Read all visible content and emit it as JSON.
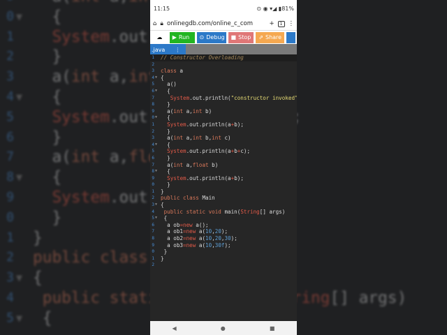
{
  "status": {
    "time": "11:15",
    "battery": "81%"
  },
  "browser": {
    "url": "onlinegdb.com/online_c_com",
    "tabs_count": "1"
  },
  "toolbar": {
    "run": "Run",
    "debug": "Debug",
    "stop": "Stop",
    "share": "Share"
  },
  "file_tab": {
    "name": ".java"
  },
  "colors": {
    "run": "#22b522",
    "debug": "#2c79c8",
    "stop": "#e07777",
    "share": "#f5a850",
    "gutter": "#4a8fd8"
  },
  "code_lines": [
    [
      [
        "c",
        "// Constructor Overloading"
      ]
    ],
    [],
    [
      [
        "k",
        "class"
      ],
      [
        "t",
        " a"
      ]
    ],
    [
      [
        "t",
        "{"
      ]
    ],
    [
      [
        "t",
        "  a()"
      ]
    ],
    [
      [
        "t",
        "  {"
      ]
    ],
    [
      [
        "t",
        "   "
      ],
      [
        "s",
        "System"
      ],
      [
        "t",
        ".out.println("
      ],
      [
        "str",
        "\"constructor invoked\""
      ],
      [
        "t",
        ");"
      ]
    ],
    [
      [
        "t",
        "  }"
      ]
    ],
    [
      [
        "t",
        "  a("
      ],
      [
        "k",
        "int"
      ],
      [
        "t",
        " a,"
      ],
      [
        "k",
        "int"
      ],
      [
        "t",
        " b)"
      ]
    ],
    [
      [
        "t",
        "  {"
      ]
    ],
    [
      [
        "t",
        "  "
      ],
      [
        "s",
        "System"
      ],
      [
        "t",
        ".out.println(a"
      ],
      [
        "s",
        "+"
      ],
      [
        "t",
        "b);"
      ]
    ],
    [
      [
        "t",
        "  }"
      ]
    ],
    [
      [
        "t",
        "  a("
      ],
      [
        "k",
        "int"
      ],
      [
        "t",
        " a,"
      ],
      [
        "k",
        "int"
      ],
      [
        "t",
        " b,"
      ],
      [
        "k",
        "int"
      ],
      [
        "t",
        " c)"
      ]
    ],
    [
      [
        "t",
        "  {"
      ]
    ],
    [
      [
        "t",
        "  "
      ],
      [
        "s",
        "System"
      ],
      [
        "t",
        ".out.println(a"
      ],
      [
        "s",
        "+"
      ],
      [
        "t",
        "b"
      ],
      [
        "s",
        "+"
      ],
      [
        "t",
        "c);"
      ]
    ],
    [
      [
        "t",
        "  }"
      ]
    ],
    [
      [
        "t",
        "  a("
      ],
      [
        "k",
        "int"
      ],
      [
        "t",
        " a,"
      ],
      [
        "k",
        "float"
      ],
      [
        "t",
        " b)"
      ]
    ],
    [
      [
        "t",
        "  {"
      ]
    ],
    [
      [
        "t",
        "  "
      ],
      [
        "s",
        "System"
      ],
      [
        "t",
        ".out.println(a"
      ],
      [
        "s",
        "+"
      ],
      [
        "t",
        "b);"
      ]
    ],
    [
      [
        "t",
        "  }"
      ]
    ],
    [
      [
        "t",
        "}"
      ]
    ],
    [
      [
        "k",
        "public class"
      ],
      [
        "t",
        " Main"
      ]
    ],
    [
      [
        "t",
        "{"
      ]
    ],
    [
      [
        "t",
        " "
      ],
      [
        "k",
        "public static void"
      ],
      [
        "t",
        " main("
      ],
      [
        "s",
        "String"
      ],
      [
        "t",
        "[] args)"
      ]
    ],
    [
      [
        "t",
        " {"
      ]
    ],
    [
      [
        "t",
        "  a ob"
      ],
      [
        "s",
        "=new"
      ],
      [
        "t",
        " a();"
      ]
    ],
    [
      [
        "t",
        "  a ob1"
      ],
      [
        "s",
        "=new"
      ],
      [
        "t",
        " a("
      ],
      [
        "n",
        "10"
      ],
      [
        "t",
        ","
      ],
      [
        "n",
        "20"
      ],
      [
        "t",
        ");"
      ]
    ],
    [
      [
        "t",
        "  a ob2"
      ],
      [
        "s",
        "=new"
      ],
      [
        "t",
        " a("
      ],
      [
        "n",
        "10"
      ],
      [
        "t",
        ","
      ],
      [
        "n",
        "20"
      ],
      [
        "t",
        ","
      ],
      [
        "n",
        "30"
      ],
      [
        "t",
        ");"
      ]
    ],
    [
      [
        "t",
        "  a ob3"
      ],
      [
        "s",
        "=new"
      ],
      [
        "t",
        " a("
      ],
      [
        "n",
        "10"
      ],
      [
        "t",
        ","
      ],
      [
        "n",
        "30f"
      ],
      [
        "t",
        ");"
      ]
    ],
    [
      [
        "t",
        " }"
      ]
    ],
    [
      [
        "t",
        "}"
      ]
    ],
    []
  ],
  "folds": [
    4,
    6,
    10,
    14,
    18,
    23,
    25
  ]
}
